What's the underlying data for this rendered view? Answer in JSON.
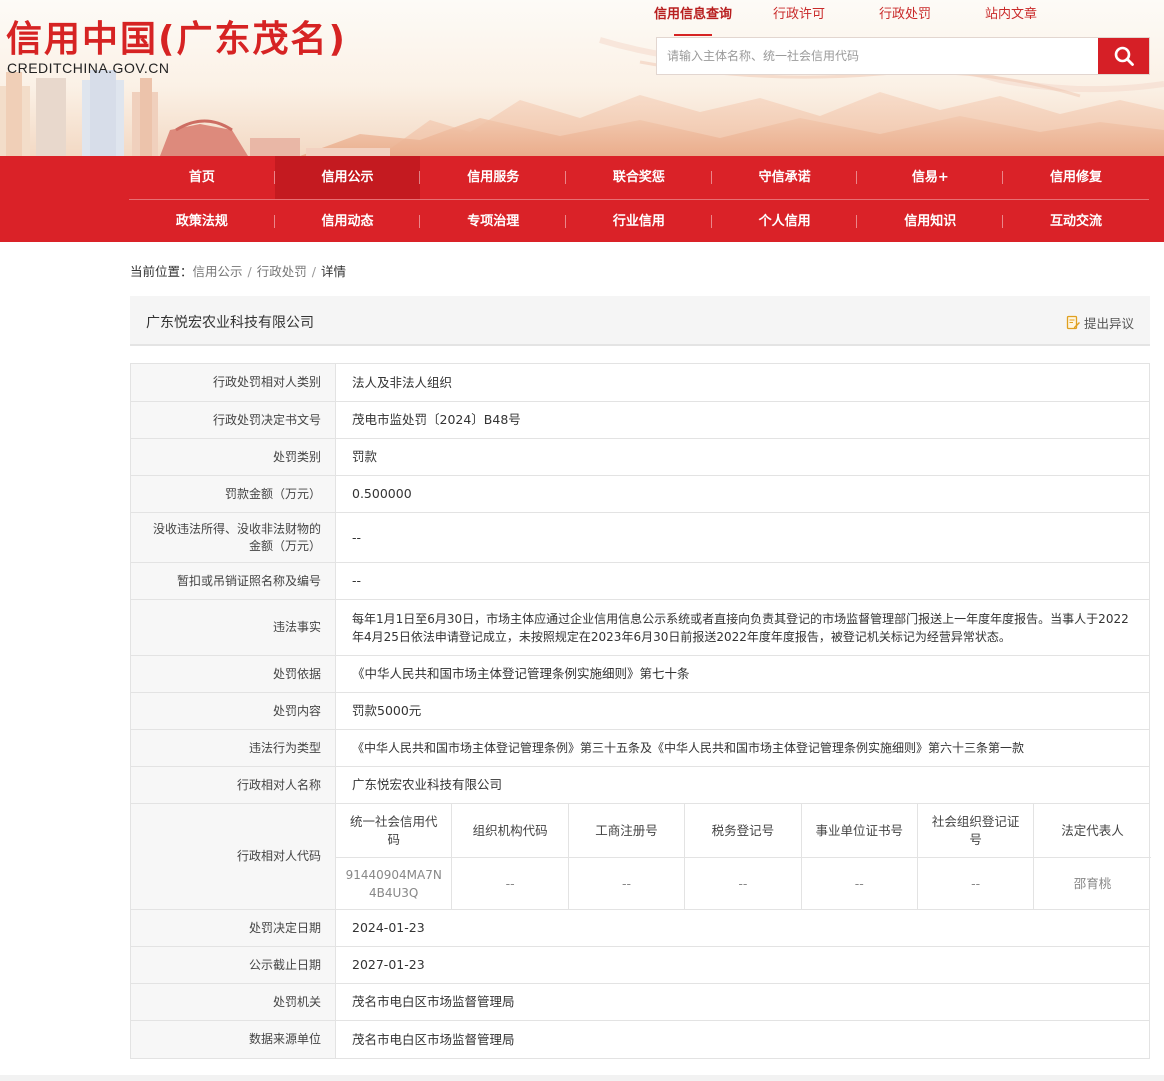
{
  "header": {
    "logo_cn": "信用中国(广东茂名)",
    "logo_en": "CREDITCHINA.GOV.CN",
    "top_links": [
      "信用信息查询",
      "行政许可",
      "行政处罚",
      "站内文章"
    ],
    "search_placeholder": "请输入主体名称、统一社会信用代码",
    "search_icon": "search-icon"
  },
  "nav": {
    "row1": [
      "首页",
      "信用公示",
      "信用服务",
      "联合奖惩",
      "守信承诺",
      "信易+",
      "信用修复"
    ],
    "row2": [
      "政策法规",
      "信用动态",
      "专项治理",
      "行业信用",
      "个人信用",
      "信用知识",
      "互动交流"
    ]
  },
  "breadcrumb": {
    "prefix": "当前位置：",
    "items": [
      "信用公示",
      "行政处罚",
      "详情"
    ],
    "separator": "/"
  },
  "title": {
    "company": "广东悦宏农业科技有限公司",
    "objection": "提出异议",
    "objection_icon": "edit-document-icon"
  },
  "details": {
    "party_type_label": "行政处罚相对人类别",
    "party_type": "法人及非法人组织",
    "doc_no_label": "行政处罚决定书文号",
    "doc_no": "茂电市监处罚〔2024〕B48号",
    "category_label": "处罚类别",
    "category": "罚款",
    "fine_label": "罚款金额（万元）",
    "fine": "0.500000",
    "confiscated_label": "没收违法所得、没收非法财物的金额（万元）",
    "confiscated": "--",
    "license_label": "暂扣或吊销证照名称及编号",
    "license": "--",
    "facts_label": "违法事实",
    "facts": "每年1月1日至6月30日，市场主体应通过企业信用信息公示系统或者直接向负责其登记的市场监督管理部门报送上一年度年度报告。当事人于2022年4月25日依法申请登记成立，未按照规定在2023年6月30日前报送2022年度年度报告，被登记机关标记为经营异常状态。",
    "basis_label": "处罚依据",
    "basis": "《中华人民共和国市场主体登记管理条例实施细则》第七十条",
    "content_label": "处罚内容",
    "content": "罚款5000元",
    "violation_type_label": "违法行为类型",
    "violation_type": "《中华人民共和国市场主体登记管理条例》第三十五条及《中华人民共和国市场主体登记管理条例实施细则》第六十三条第一款",
    "party_name_label": "行政相对人名称",
    "party_name": "广东悦宏农业科技有限公司",
    "party_code_label": "行政相对人代码",
    "code_headers": [
      "统一社会信用代码",
      "组织机构代码",
      "工商注册号",
      "税务登记号",
      "事业单位证书号",
      "社会组织登记证号",
      "法定代表人"
    ],
    "code_values": [
      "91440904MA7N4B4U3Q",
      "--",
      "--",
      "--",
      "--",
      "--",
      "邵育桃"
    ],
    "decision_date_label": "处罚决定日期",
    "decision_date": "2024-01-23",
    "publish_end_label": "公示截止日期",
    "publish_end": "2027-01-23",
    "authority_label": "处罚机关",
    "authority": "茂名市电白区市场监督管理局",
    "source_label": "数据来源单位",
    "source": "茂名市电白区市场监督管理局"
  },
  "colors": {
    "brand_red": "#da2228",
    "logo_red": "#d62323",
    "label_bg": "#f7f7f7",
    "border": "#e3e3e3"
  }
}
